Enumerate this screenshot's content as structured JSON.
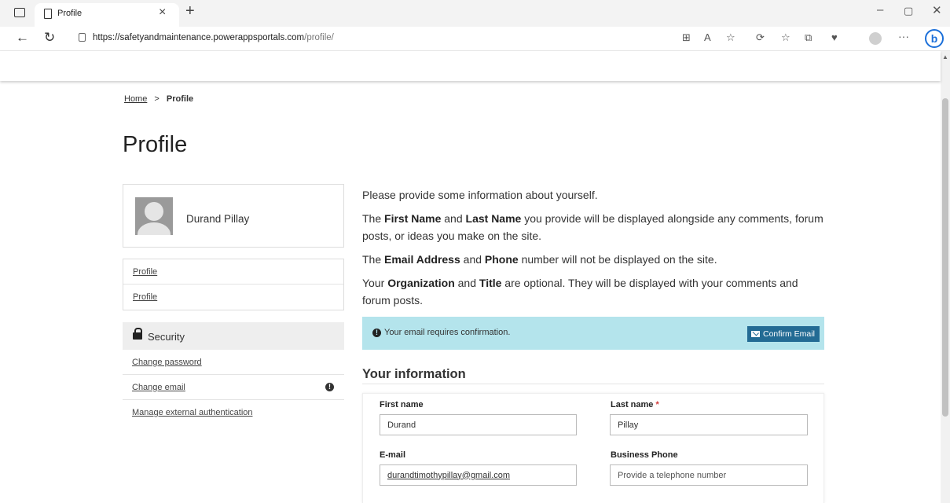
{
  "browser": {
    "tab_title": "Profile",
    "tab_close": "×",
    "new_tab": "+",
    "url_host": "https://safetyandmaintenance.powerappsportals.com",
    "url_path": "/profile/",
    "bing_label": "b",
    "more_label": "···"
  },
  "breadcrumb": {
    "home": "Home",
    "separator": ">",
    "current": "Profile"
  },
  "page_title": "Profile",
  "profile": {
    "name": "Durand Pillay"
  },
  "nav": {
    "items": [
      {
        "label": "Profile"
      },
      {
        "label": "Profile"
      }
    ]
  },
  "security": {
    "heading": "Security",
    "items": [
      {
        "label": "Change password"
      },
      {
        "label": "Change email"
      },
      {
        "label": "Manage external authentication"
      }
    ]
  },
  "intro": {
    "line1": "Please provide some information about yourself.",
    "p2_a": "The ",
    "p2_b1": "First Name",
    "p2_c": " and ",
    "p2_b2": "Last Name",
    "p2_d": " you provide will be displayed alongside any comments, forum posts, or ideas you make on the site.",
    "p3_a": "The ",
    "p3_b1": "Email Address",
    "p3_c": " and ",
    "p3_b2": "Phone",
    "p3_d": " number will not be displayed on the site.",
    "p4_a": "Your ",
    "p4_b1": "Organization",
    "p4_c": " and ",
    "p4_b2": "Title",
    "p4_d": " are optional. They will be displayed with your comments and forum posts."
  },
  "alert": {
    "text": "Your email requires confirmation.",
    "button": "Confirm Email",
    "color": "#b4e4ec",
    "button_color": "#236b94"
  },
  "form": {
    "section_title": "Your information",
    "first_name": {
      "label": "First name",
      "value": "Durand"
    },
    "last_name": {
      "label": "Last name",
      "required": "*",
      "value": "Pillay"
    },
    "email": {
      "label": "E-mail",
      "value": "durandtimothypillay@gmail.com"
    },
    "business_phone": {
      "label": "Business Phone",
      "placeholder": "Provide a telephone number"
    }
  }
}
